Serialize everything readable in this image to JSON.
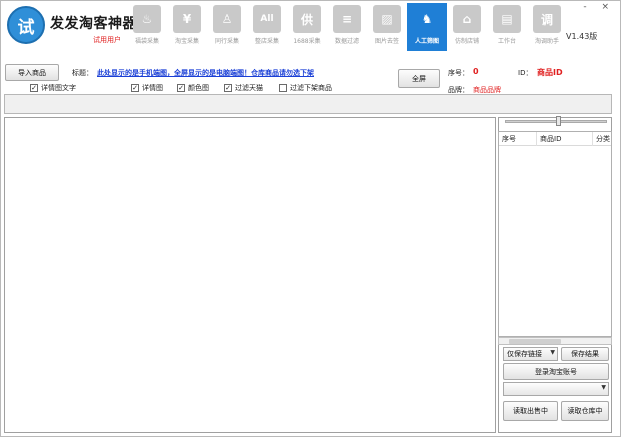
{
  "app": {
    "logo_char": "试",
    "title": "发发淘客神器",
    "subtitle": "试用用户",
    "version": "V1.43版",
    "window_controls": "- ×"
  },
  "toolbar": [
    {
      "label": "福袋采集",
      "icon": "flame-icon",
      "glyph": "♨"
    },
    {
      "label": "淘宝采集",
      "icon": "yen-icon",
      "glyph": "¥"
    },
    {
      "label": "同行采集",
      "icon": "person-icon",
      "glyph": "♙"
    },
    {
      "label": "整店采集",
      "icon": "all-icon",
      "glyph": "All"
    },
    {
      "label": "1688采集",
      "icon": "supply-icon",
      "glyph": "供"
    },
    {
      "label": "数据过滤",
      "icon": "filter-icon",
      "glyph": "≡"
    },
    {
      "label": "图片去签",
      "icon": "picture-icon",
      "glyph": "▨"
    },
    {
      "label": "人工筛图",
      "icon": "person-sweep-icon",
      "glyph": "♞",
      "active": true
    },
    {
      "label": "仿制店铺",
      "icon": "shop-icon",
      "glyph": "⌂"
    },
    {
      "label": "工作台",
      "icon": "workbench-icon",
      "glyph": "▤"
    },
    {
      "label": "淘调助手",
      "icon": "assistant-icon",
      "glyph": "调"
    }
  ],
  "controls": {
    "import_button": "导入商品",
    "title_label": "标题：",
    "title_link": "此处显示的是手机端图，全屏显示的是电脑端图！仓库商品请勿选下架",
    "fullscreen_button": "全屏",
    "seq_label": "序号：",
    "seq_value": "0",
    "id_label": "ID：",
    "id_value": "商品ID",
    "brand_label": "品牌：",
    "brand_value": "商品品牌"
  },
  "checkboxes": [
    {
      "label": "详情图文字",
      "checked": true
    },
    {
      "label": "详情图",
      "checked": true
    },
    {
      "label": "颜色图",
      "checked": true
    },
    {
      "label": "过滤天猫",
      "checked": true
    },
    {
      "label": "过滤下架商品",
      "checked": false
    }
  ],
  "grid": {
    "columns": [
      "序号",
      "商品ID",
      "分类"
    ]
  },
  "right_panel": {
    "save_mode_value": "仅保存链接",
    "save_result_button": "保存结果",
    "login_button": "登录淘宝账号",
    "account_select_value": "",
    "read_sale_button": "读取出售中",
    "read_warehouse_button": "读取仓库中"
  }
}
